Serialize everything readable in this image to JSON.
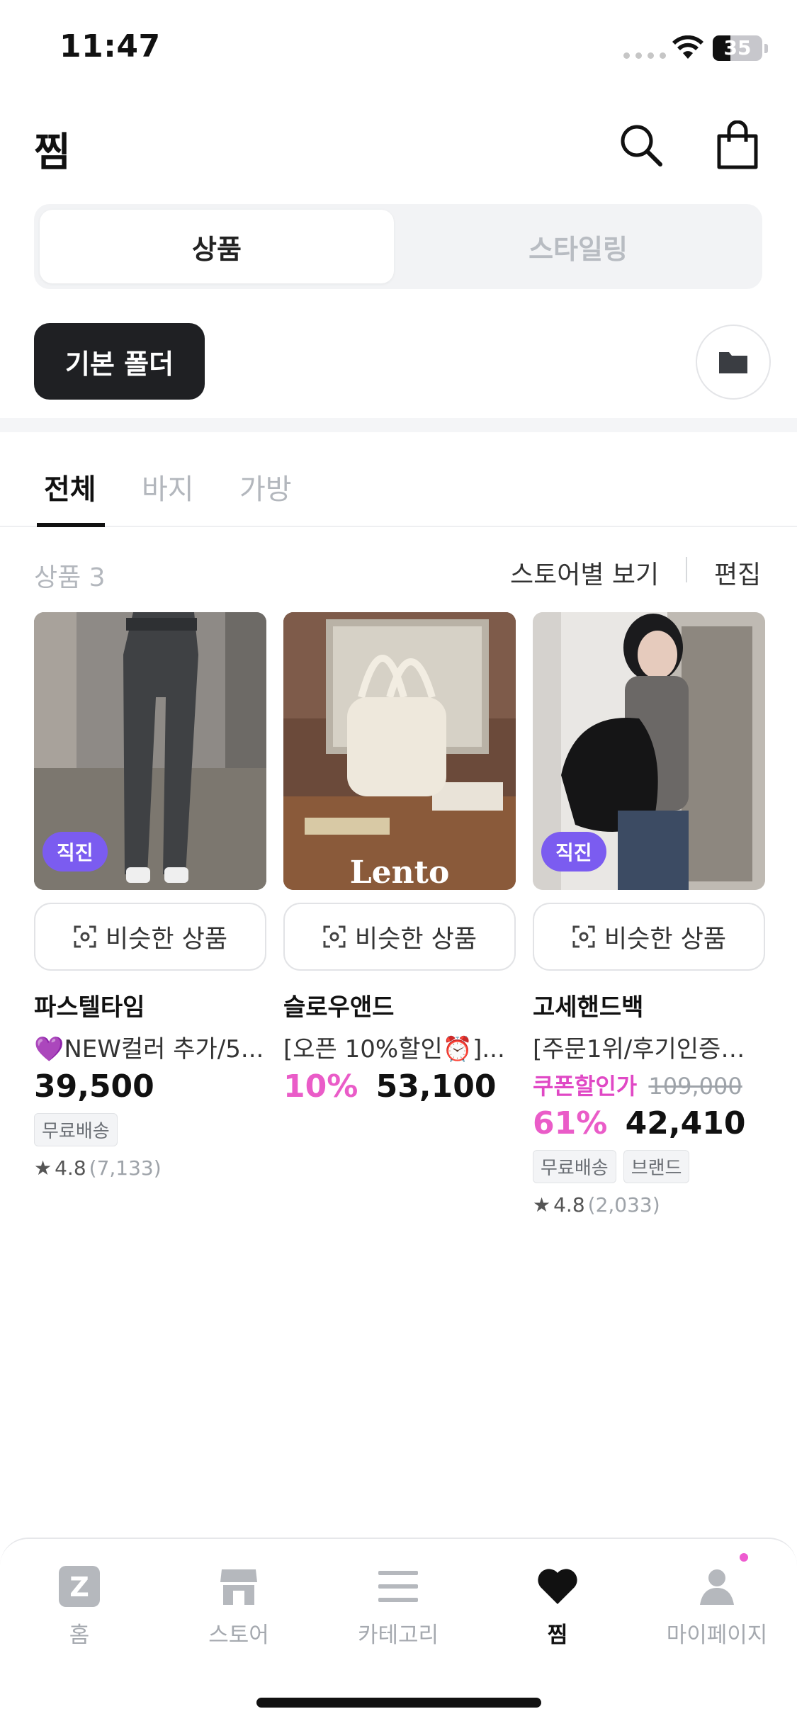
{
  "status_bar": {
    "time": "11:47",
    "battery": "35"
  },
  "header": {
    "title": "찜"
  },
  "segment": {
    "active": "상품",
    "inactive": "스타일링"
  },
  "folder": {
    "label": "기본 폴더"
  },
  "tabs": [
    {
      "label": "전체"
    },
    {
      "label": "바지"
    },
    {
      "label": "가방"
    }
  ],
  "list_toolbar": {
    "count": "상품 3",
    "store_view": "스토어별 보기",
    "edit": "편집"
  },
  "products": [
    {
      "badge": "직진",
      "similar": "비슷한 상품",
      "brand": "파스텔타임",
      "name": "💜NEW컬러 추가/5...",
      "price": "39,500",
      "tags": [
        "무료배송"
      ],
      "rating": "4.8",
      "rating_count": "(7,133)"
    },
    {
      "similar": "비슷한 상품",
      "brand": "슬로우앤드",
      "name": "[오픈 10%할인⏰]...",
      "discount": "10%",
      "price": "53,100",
      "image_text": "Lento"
    },
    {
      "badge": "직진",
      "similar": "비슷한 상품",
      "brand": "고세핸드백",
      "name": "[주문1위/후기인증템...",
      "coupon_label": "쿠폰할인가",
      "original_price": "109,000",
      "discount": "61%",
      "price": "42,410",
      "tags": [
        "무료배송",
        "브랜드"
      ],
      "rating": "4.8",
      "rating_count": "(2,033)"
    }
  ],
  "bottom_nav": [
    {
      "label": "홈",
      "icon": "z-logo-icon"
    },
    {
      "label": "스토어",
      "icon": "store-icon"
    },
    {
      "label": "카테고리",
      "icon": "menu-icon"
    },
    {
      "label": "찜",
      "icon": "heart-icon",
      "active": true
    },
    {
      "label": "마이페이지",
      "icon": "person-icon"
    }
  ],
  "colors": {
    "accent_purple": "#7b5cf0",
    "discount_pink": "#ea5cc8",
    "dark": "#1f2023"
  }
}
